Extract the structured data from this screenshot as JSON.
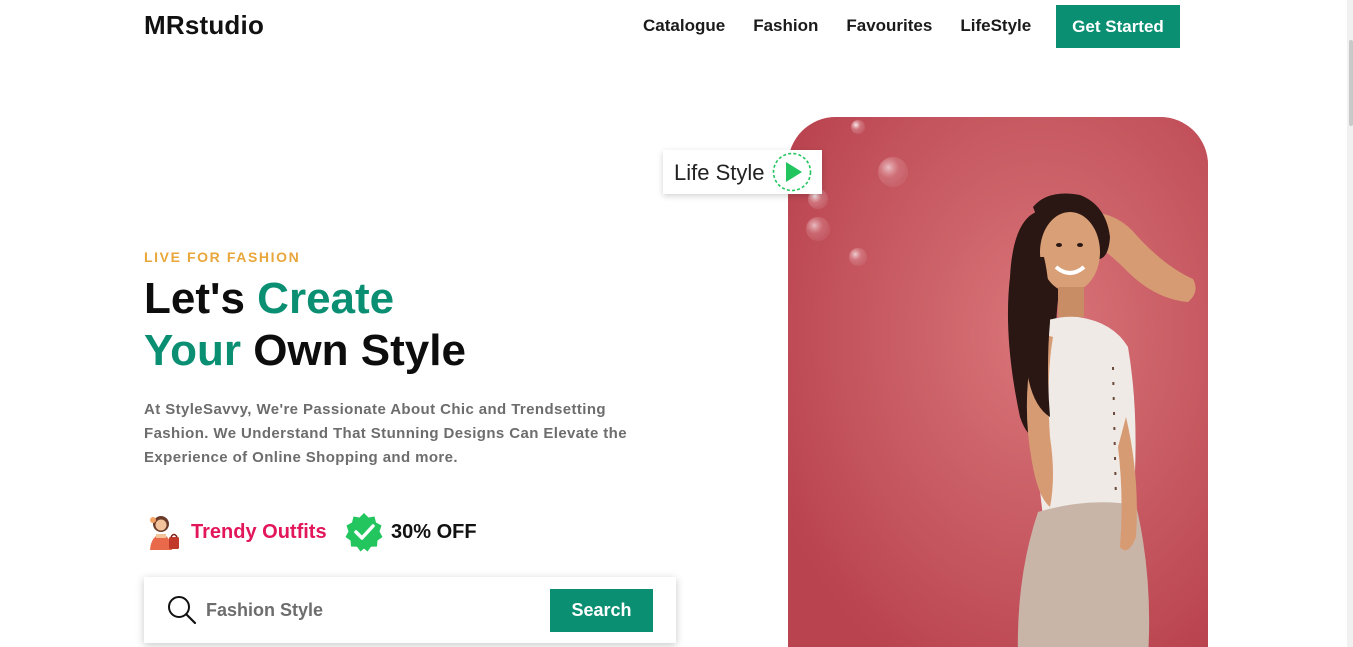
{
  "header": {
    "logo": "MRstudio",
    "nav": [
      "Catalogue",
      "Fashion",
      "Favourites",
      "LifeStyle"
    ],
    "cta": "Get Started"
  },
  "hero": {
    "eyebrow": "LIVE FOR FASHION",
    "headline": {
      "w1": "Let's",
      "w2": "Create",
      "w3": "Your",
      "w4": "Own Style"
    },
    "description": "At StyleSavvy, We're Passionate About Chic and Trendsetting Fashion. We Understand That Stunning Designs Can Elevate the Experience of Online Shopping and more.",
    "features": [
      {
        "label": "Trendy Outfits",
        "icon": "shopper-avatar-icon"
      },
      {
        "label": "30% OFF",
        "icon": "verified-badge-icon"
      }
    ],
    "search": {
      "placeholder": "Fashion Style",
      "button": "Search"
    },
    "video_pill": {
      "label": "Life Style",
      "icon": "play-icon"
    }
  },
  "colors": {
    "accent": "#0a8f72",
    "eyebrow": "#e9a63a",
    "pink": "#e2165a",
    "photo_bg": "#c4505c"
  }
}
